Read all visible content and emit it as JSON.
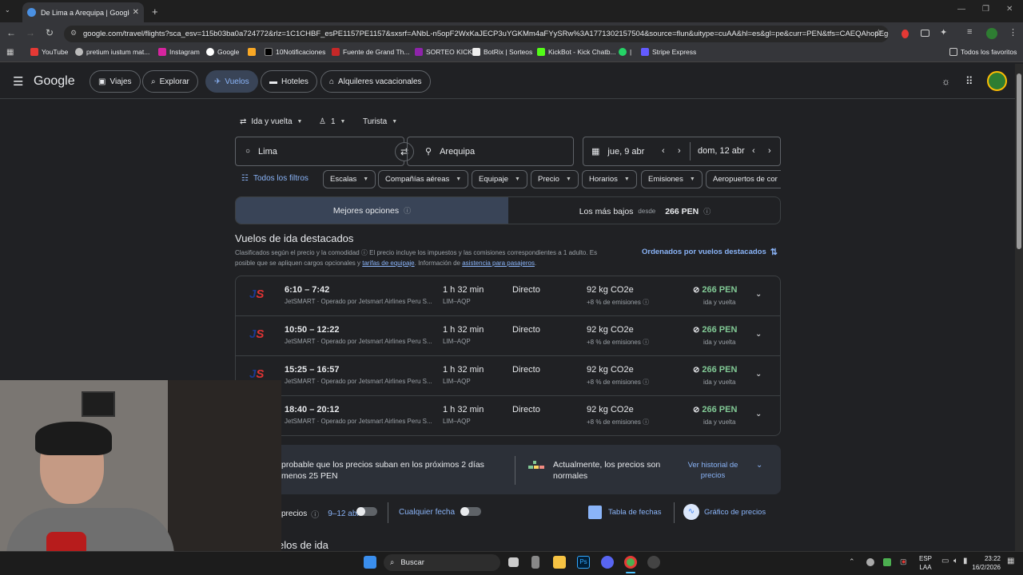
{
  "browser": {
    "tab_title": "De Lima a Arequipa | Google Vu",
    "url": "google.com/travel/flights?sca_esv=115b03ba0a724772&rlz=1C1CHBF_esPE1157PE1157&sxsrf=ANbL-n5opF2WxKaJECP3uYGKMm4aFYySRw%3A1771302157504&source=flun&uitype=cuAA&hl=es&gl=pe&curr=PEN&tfs=CAEQAhopEgo...",
    "bookmarks": [
      {
        "label": "YouTube"
      },
      {
        "label": "pretium iustum mat..."
      },
      {
        "label": "Instagram"
      },
      {
        "label": "Google"
      },
      {
        "label": ""
      },
      {
        "label": "10Notificaciones"
      },
      {
        "label": "Fuente de Grand Th..."
      },
      {
        "label": "SORTEO KICK"
      },
      {
        "label": "BotRix | Sorteos"
      },
      {
        "label": "KickBot - Kick Chatb..."
      },
      {
        "label": "|"
      },
      {
        "label": "Stripe Express"
      }
    ],
    "all_bookmarks": "Todos los favoritos"
  },
  "header": {
    "logo": "Google",
    "nav": [
      {
        "label": "Viajes"
      },
      {
        "label": "Explorar"
      },
      {
        "label": "Vuelos"
      },
      {
        "label": "Hoteles"
      },
      {
        "label": "Alquileres vacacionales"
      }
    ]
  },
  "search": {
    "trip_type": "Ida y vuelta",
    "passengers": "1",
    "cabin": "Turista",
    "origin": "Lima",
    "destination": "Arequipa",
    "depart": "jue, 9 abr",
    "return": "dom, 12 abr"
  },
  "filters": {
    "all": "Todos los filtros",
    "chips": [
      "Escalas",
      "Compañías aéreas",
      "Equipaje",
      "Precio",
      "Horarios",
      "Emisiones",
      "Aeropuertos de cor"
    ]
  },
  "sort_tabs": {
    "best": "Mejores opciones",
    "cheapest": "Los más bajos",
    "from": "desde",
    "cheapest_price": "266 PEN"
  },
  "results": {
    "title": "Vuelos de ida destacados",
    "note_1": "Clasificados según el precio y la comodidad",
    "note_2": "El precio incluye los impuestos y las comisiones correspondientes a 1 adulto. Es",
    "note_3": "posible que se apliquen cargos opcionales y",
    "note_link_1": "tarifas de equipaje",
    "note_4": ". Información de",
    "note_link_2": "asistencia para pasajeros",
    "note_5": ".",
    "sort_label": "Ordenados por vuelos destacados",
    "flights": [
      {
        "time": "6:10 – 7:42",
        "airline": "JetSMART · Operado por Jetsmart Airlines Peru S...",
        "duration": "1 h 32 min",
        "route": "LIM–AQP",
        "stops": "Directo",
        "co2": "92 kg CO2e",
        "emissions": "+8 % de emisiones",
        "price": "266 PEN",
        "price_type": "ida y vuelta"
      },
      {
        "time": "10:50 – 12:22",
        "airline": "JetSMART · Operado por Jetsmart Airlines Peru S...",
        "duration": "1 h 32 min",
        "route": "LIM–AQP",
        "stops": "Directo",
        "co2": "92 kg CO2e",
        "emissions": "+8 % de emisiones",
        "price": "266 PEN",
        "price_type": "ida y vuelta"
      },
      {
        "time": "15:25 – 16:57",
        "airline": "JetSMART · Operado por Jetsmart Airlines Peru S...",
        "duration": "1 h 32 min",
        "route": "LIM–AQP",
        "stops": "Directo",
        "co2": "92 kg CO2e",
        "emissions": "+8 % de emisiones",
        "price": "266 PEN",
        "price_type": "ida y vuelta"
      },
      {
        "time": "18:40 – 20:12",
        "airline": "JetSMART · Operado por Jetsmart Airlines Peru S...",
        "duration": "1 h 32 min",
        "route": "LIM–AQP",
        "stops": "Directo",
        "co2": "92 kg CO2e",
        "emissions": "+8 % de emisiones",
        "price": "266 PEN",
        "price_type": "ida y vuelta"
      }
    ]
  },
  "insight": {
    "left_line1": "probable que los precios suban en los próximos 2 días",
    "left_line2": "menos 25 PEN",
    "right": "Actualmente, los precios son normales",
    "history_link": "Ver historial de precios"
  },
  "track": {
    "label": "precios",
    "dates": "9–12 abr",
    "any_date": "Cualquier fecha",
    "date_grid": "Tabla de fechas",
    "price_graph": "Gráfico de precios"
  },
  "section2_title": "elos de ida",
  "taskbar": {
    "search": "Buscar",
    "lang1": "ESP",
    "lang2": "LAA",
    "time": "23:22",
    "date": "16/2/2026"
  },
  "colors": {
    "background": "#202124",
    "accent": "#8ab4f8",
    "price_green": "#81c995",
    "active_chip": "#394457"
  }
}
